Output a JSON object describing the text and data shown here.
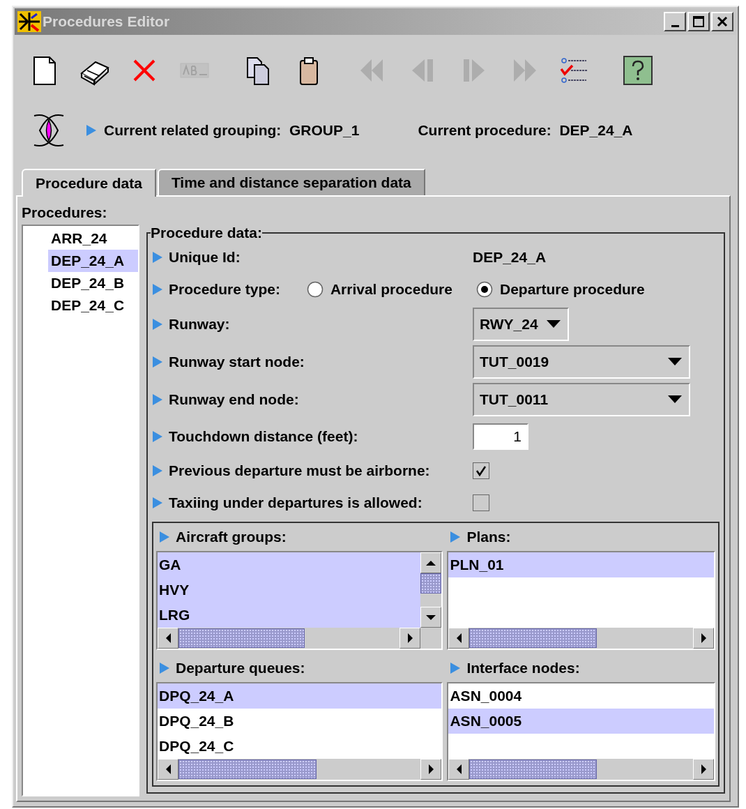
{
  "window": {
    "title": "Procedures Editor"
  },
  "toolbar": [
    {
      "kind": "new",
      "disabled": false
    },
    {
      "kind": "eraser",
      "disabled": false
    },
    {
      "kind": "delete",
      "disabled": false
    },
    {
      "kind": "rename",
      "disabled": true
    },
    {
      "kind": "copy",
      "disabled": false
    },
    {
      "kind": "paste",
      "disabled": false
    },
    {
      "kind": "first",
      "disabled": true
    },
    {
      "kind": "previous",
      "disabled": true
    },
    {
      "kind": "next",
      "disabled": true
    },
    {
      "kind": "last",
      "disabled": true
    },
    {
      "kind": "checklist",
      "disabled": false
    },
    {
      "kind": "help",
      "disabled": false
    }
  ],
  "context": {
    "grouping_label": "Current related grouping:",
    "grouping_value": "GROUP_1",
    "procedure_label": "Current procedure:",
    "procedure_value": "DEP_24_A"
  },
  "tabs": [
    {
      "label": "Procedure data",
      "selected": true
    },
    {
      "label": "Time and distance separation data",
      "selected": false
    }
  ],
  "procedures": {
    "label": "Procedures:",
    "items": [
      {
        "label": "ARR_24",
        "selected": false
      },
      {
        "label": "DEP_24_A",
        "selected": true
      },
      {
        "label": "DEP_24_B",
        "selected": false
      },
      {
        "label": "DEP_24_C",
        "selected": false
      }
    ]
  },
  "procedure_data": {
    "title": "Procedure data:",
    "fields": [
      {
        "kind": "text",
        "label": "Unique Id:",
        "value": "DEP_24_A"
      },
      {
        "kind": "radio",
        "label": "Procedure type:",
        "options": [
          {
            "label": "Arrival procedure",
            "selected": false
          },
          {
            "label": "Departure procedure",
            "selected": true
          }
        ]
      },
      {
        "kind": "select",
        "label": "Runway:",
        "value": "RWY_24"
      },
      {
        "kind": "select",
        "label": "Runway start node:",
        "value": "TUT_0019"
      },
      {
        "kind": "select",
        "label": "Runway end node:",
        "value": "TUT_0011"
      },
      {
        "kind": "number",
        "label": "Touchdown distance (feet):",
        "value": "1"
      },
      {
        "kind": "checkbox",
        "label": "Previous departure must be airborne:",
        "checked": true
      },
      {
        "kind": "checkbox",
        "label": "Taxiing under departures is allowed:",
        "checked": false
      }
    ],
    "lists": [
      {
        "title": "Aircraft groups:",
        "vertical_scrollbar": true,
        "items": [
          {
            "label": "GA",
            "selected": true
          },
          {
            "label": "HVY",
            "selected": true
          },
          {
            "label": "LRG",
            "selected": true
          }
        ]
      },
      {
        "title": "Plans:",
        "vertical_scrollbar": false,
        "items": [
          {
            "label": "PLN_01",
            "selected": true
          }
        ]
      },
      {
        "title": "Departure queues:",
        "vertical_scrollbar": false,
        "items": [
          {
            "label": "DPQ_24_A",
            "selected": true
          },
          {
            "label": "DPQ_24_B",
            "selected": false
          },
          {
            "label": "DPQ_24_C",
            "selected": false
          }
        ]
      },
      {
        "title": "Interface nodes:",
        "vertical_scrollbar": false,
        "items": [
          {
            "label": "ASN_0004",
            "selected": false
          },
          {
            "label": "ASN_0005",
            "selected": true
          }
        ]
      }
    ]
  }
}
